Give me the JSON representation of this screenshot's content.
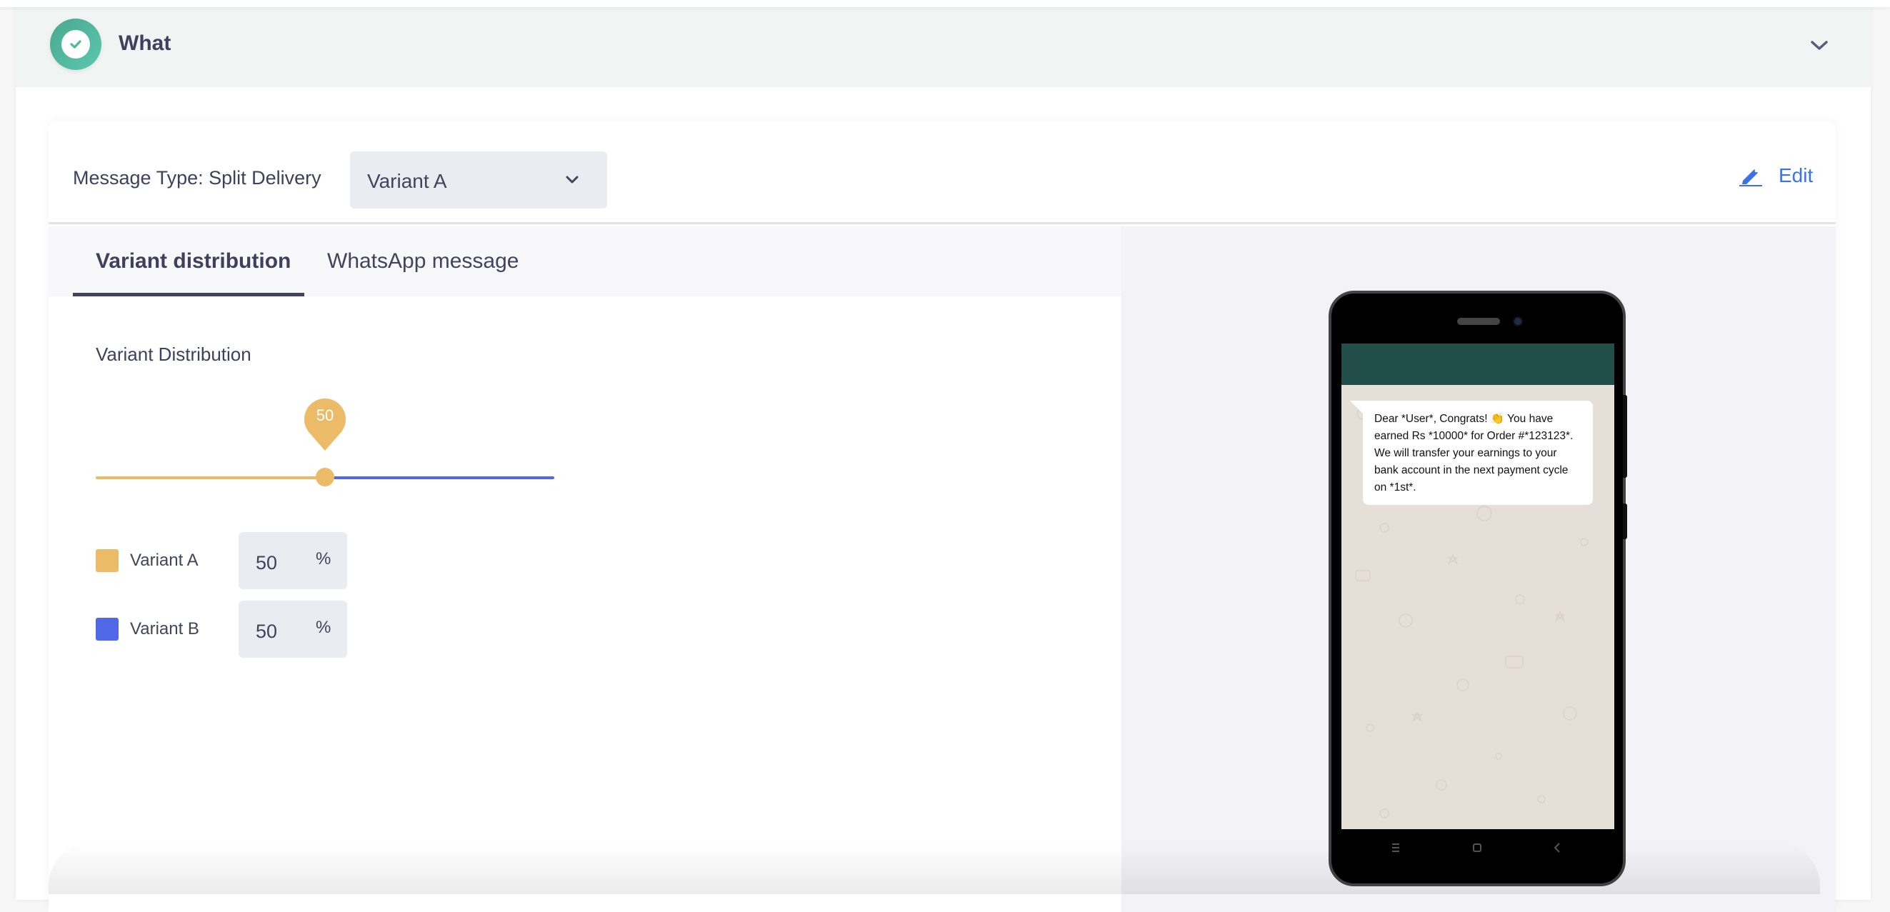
{
  "section": {
    "title": "What",
    "status_icon": "check-circle-icon",
    "collapse_icon": "chevron-down-icon"
  },
  "message_config": {
    "message_type_label": "Message Type: Split Delivery",
    "variant_select": {
      "selected": "Variant A",
      "icon": "chevron-down-icon"
    },
    "edit": {
      "label": "Edit",
      "icon": "pencil-icon"
    }
  },
  "tabs": [
    {
      "label": "Variant distribution",
      "active": true
    },
    {
      "label": "WhatsApp message",
      "active": false
    }
  ],
  "distribution": {
    "title": "Variant Distribution",
    "slider": {
      "value": 50,
      "min": 0,
      "max": 100,
      "tooltip": "50"
    },
    "variants": [
      {
        "label": "Variant A",
        "value": "50",
        "unit": "%",
        "color": "#ebbb68"
      },
      {
        "label": "Variant B",
        "value": "50",
        "unit": "%",
        "color": "#5068e8"
      }
    ]
  },
  "preview": {
    "header_color": "#214e48",
    "message": "Dear *User*, Congrats! 👏 You have earned Rs *10000* for Order #*123123*. We will transfer your earnings to your bank account in the next payment cycle on *1st*.",
    "nav_icons": [
      "menu-icon",
      "home-icon",
      "back-icon"
    ]
  },
  "colors": {
    "accent_green": "#4fb89e",
    "link_blue": "#3a73e6",
    "text_dark": "#3f405e"
  }
}
